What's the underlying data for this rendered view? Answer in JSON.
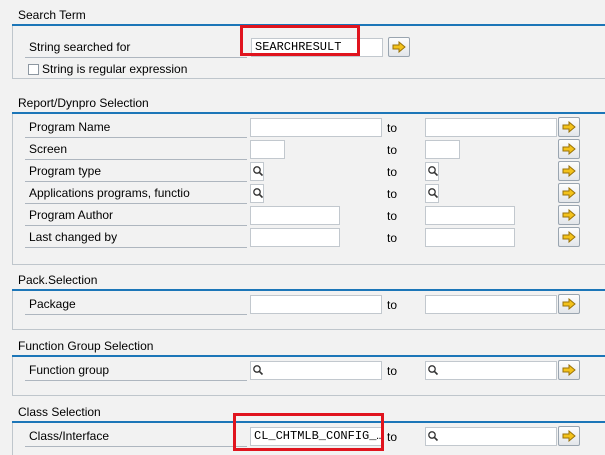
{
  "search_term": {
    "title": "Search Term",
    "string_label": "String searched for",
    "string_value": "SEARCHRESULT",
    "regex_label": "String is regular expression",
    "regex_checked": false
  },
  "report": {
    "title": "Report/Dynpro Selection",
    "rows": [
      {
        "label": "Program Name",
        "to": "to"
      },
      {
        "label": "Screen",
        "to": "to"
      },
      {
        "label": "Program type",
        "to": "to"
      },
      {
        "label": "Applications programs, functio",
        "to": "to"
      },
      {
        "label": "Program Author",
        "to": "to"
      },
      {
        "label": "Last changed by",
        "to": "to"
      }
    ]
  },
  "pack": {
    "title": "Pack.Selection",
    "rows": [
      {
        "label": "Package",
        "to": "to"
      }
    ]
  },
  "fg": {
    "title": "Function Group Selection",
    "rows": [
      {
        "label": "Function group",
        "to": "to"
      }
    ]
  },
  "cls": {
    "title": "Class Selection",
    "rows": [
      {
        "label": "Class/Interface",
        "value": "CL_CHTMLB_CONFIG_…",
        "to": "to"
      }
    ]
  },
  "colors": {
    "section_line": "#1c76b8",
    "highlight": "#e0141e",
    "background": "#f2f2f2"
  },
  "icons": {
    "multiple_selection": "arrow-right-icon",
    "value_help": "search-icon"
  }
}
